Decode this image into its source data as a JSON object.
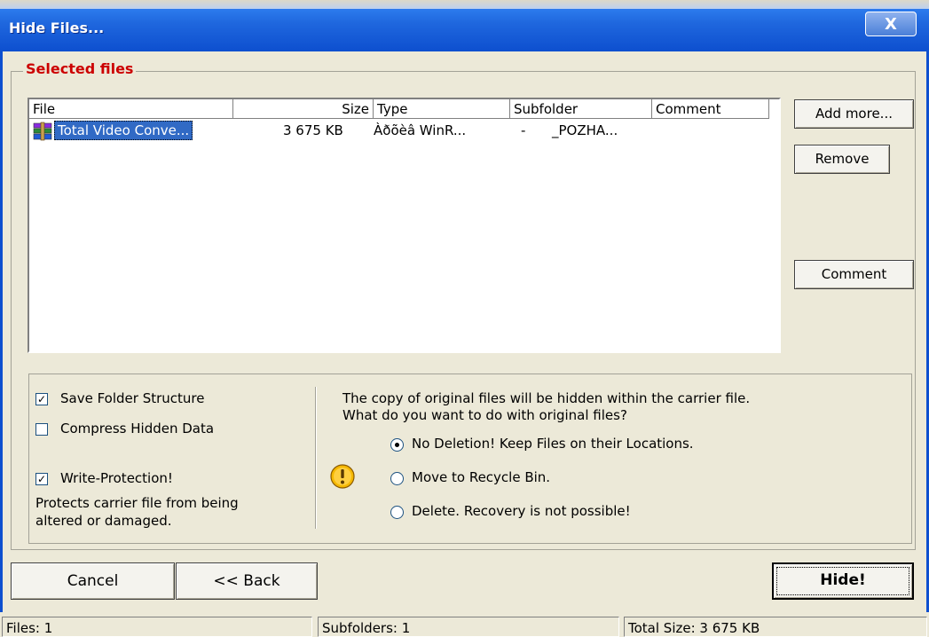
{
  "window": {
    "title": "Hide Files...",
    "close_label": "X"
  },
  "group": {
    "title": "Selected files"
  },
  "list": {
    "columns": [
      "File",
      "Size",
      "Type",
      "Subfolder",
      "Comment"
    ],
    "rows": [
      {
        "file": "Total Video Conve...",
        "size": "3 675 KB",
        "type": "Àðõèâ WinR...",
        "subfolder": "-",
        "comment": "_POZHA..."
      }
    ]
  },
  "side_buttons": {
    "add_more": "Add more...",
    "remove": "Remove",
    "comment": "Comment"
  },
  "options": {
    "save_folder_structure": {
      "label": "Save Folder Structure",
      "checked": true
    },
    "compress_hidden_data": {
      "label": "Compress Hidden Data",
      "checked": false
    },
    "write_protection": {
      "label": "Write-Protection!",
      "checked": true
    },
    "write_protection_note_1": "Protects carrier file from being",
    "write_protection_note_2": "altered or damaged.",
    "info_line_1": "The copy of original files will be hidden within the carrier file.",
    "info_line_2": "What do you want to do with original files?",
    "radio_options": [
      {
        "label": "No Deletion! Keep Files on their Locations.",
        "selected": true
      },
      {
        "label": "Move to Recycle Bin.",
        "selected": false
      },
      {
        "label": "Delete. Recovery is not possible!",
        "selected": false
      }
    ]
  },
  "footer_buttons": {
    "cancel": "Cancel",
    "back": "<< Back",
    "hide": "Hide!"
  },
  "status": {
    "files": "Files: 1",
    "subfolders": "Subfolders: 1",
    "total_size": "Total Size: 3 675 KB"
  },
  "icons": {
    "file_icon": "winrar-archive-icon",
    "warning_icon": "warning-icon"
  },
  "colors": {
    "title_bar": "#1f67de",
    "group_title": "#cc0000",
    "selection": "#316ac5",
    "background": "#ece9d8"
  }
}
